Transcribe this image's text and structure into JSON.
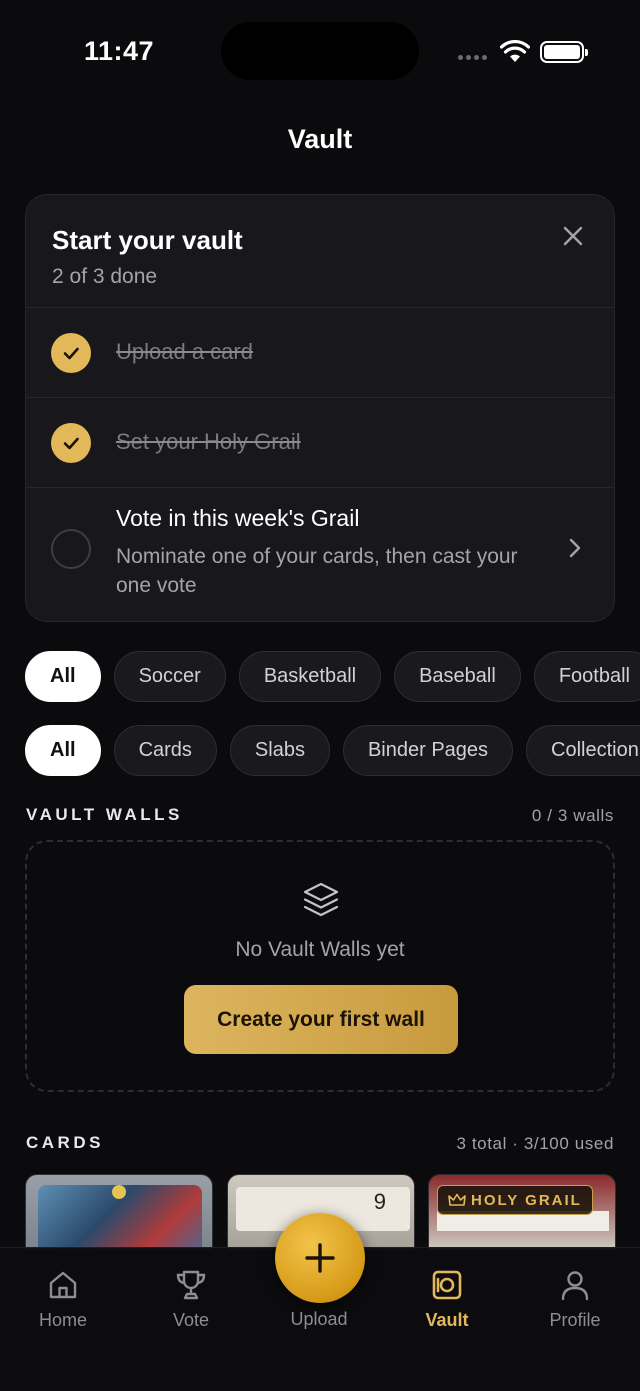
{
  "status_bar": {
    "time": "11:47"
  },
  "header": {
    "title": "Vault"
  },
  "checklist": {
    "title": "Start your vault",
    "progress": "2 of 3 done",
    "items": [
      {
        "label": "Upload a card",
        "done": true
      },
      {
        "label": "Set your Holy Grail",
        "done": true
      },
      {
        "label": "Vote in this week's Grail",
        "description": "Nominate one of your cards, then cast your one vote",
        "done": false
      }
    ]
  },
  "sport_filters": [
    "All",
    "Soccer",
    "Basketball",
    "Baseball",
    "Football"
  ],
  "type_filters": [
    "All",
    "Cards",
    "Slabs",
    "Binder Pages",
    "Collection"
  ],
  "vault_walls": {
    "heading": "VAULT WALLS",
    "count": "0 / 3 walls",
    "empty_text": "No Vault Walls yet",
    "create_button": "Create your first wall"
  },
  "cards": {
    "heading": "CARDS",
    "summary": "3 total · 3/100 used",
    "holy_grail_badge": "HOLY GRAIL",
    "slab_grade": "9"
  },
  "tabbar": {
    "home": "Home",
    "vote": "Vote",
    "upload": "Upload",
    "vault": "Vault",
    "profile": "Profile"
  },
  "colors": {
    "accent": "#e2b858",
    "background": "#0b0b0d",
    "surface": "#18181c"
  }
}
